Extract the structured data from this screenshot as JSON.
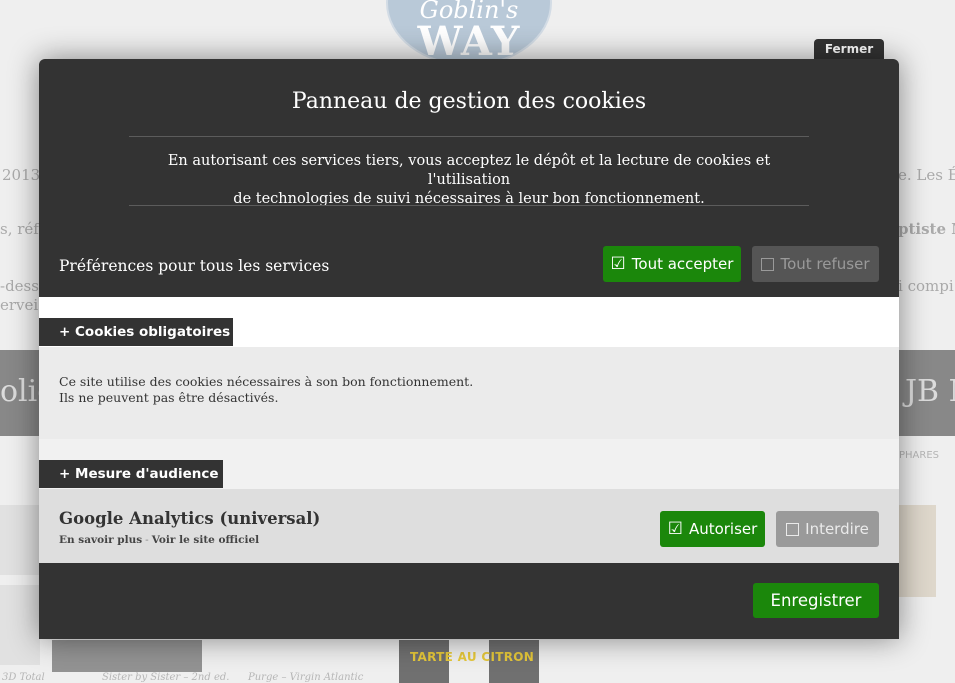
{
  "background": {
    "logo_line1": "Goblin's",
    "logo_line2": "WAY",
    "fragments": {
      "left_2013": "2013",
      "left_refe": "s, réfé",
      "left_desso": "-desso",
      "left_servei": "ervei",
      "right_les": "e. Les É",
      "right_baptiste": "ptiste M",
      "right_compil": "i compi",
      "band_left": "olio",
      "band_right": "JB M",
      "right_phares": "PHARES",
      "bottom_total": "3D Total",
      "bottom_sister": "Sister by Sister – 2nd ed.",
      "bottom_purge": "Purge – Virgin Atlantic"
    }
  },
  "brand": "TARTE AU CITRON",
  "panel": {
    "close_label": "Fermer",
    "title": "Panneau de gestion des cookies",
    "description_line1": "En autorisant ces services tiers, vous acceptez le dépôt et la lecture de cookies et l'utilisation",
    "description_line2": "de technologies de suivi nécessaires à leur bon fonctionnement.",
    "all_services_label": "Préférences pour tous les services",
    "accept_all_label": "Tout accepter",
    "deny_all_label": "Tout refuser",
    "checkbox_checked_glyph": "☑",
    "mandatory": {
      "title": "+ Cookies obligatoires",
      "text_line1": "Ce site utilise des cookies nécessaires à son bon fonctionnement.",
      "text_line2": "Ils ne peuvent pas être désactivés."
    },
    "audience": {
      "title": "+ Mesure d'audience",
      "service": {
        "name": "Google Analytics (universal)",
        "learn_more": "En savoir plus",
        "separator": "-",
        "official_site": "Voir le site officiel",
        "allow_label": "Autoriser",
        "deny_label": "Interdire"
      }
    },
    "save_label": "Enregistrer"
  },
  "colors": {
    "panel_bg": "#333333",
    "accept_green": "#1b870b",
    "deny_gray": "#555555",
    "brand_yellow": "#e6c83a"
  },
  "icons": {
    "checkbox_checked": "checkbox-checked-icon",
    "checkbox_empty": "checkbox-empty-icon"
  }
}
